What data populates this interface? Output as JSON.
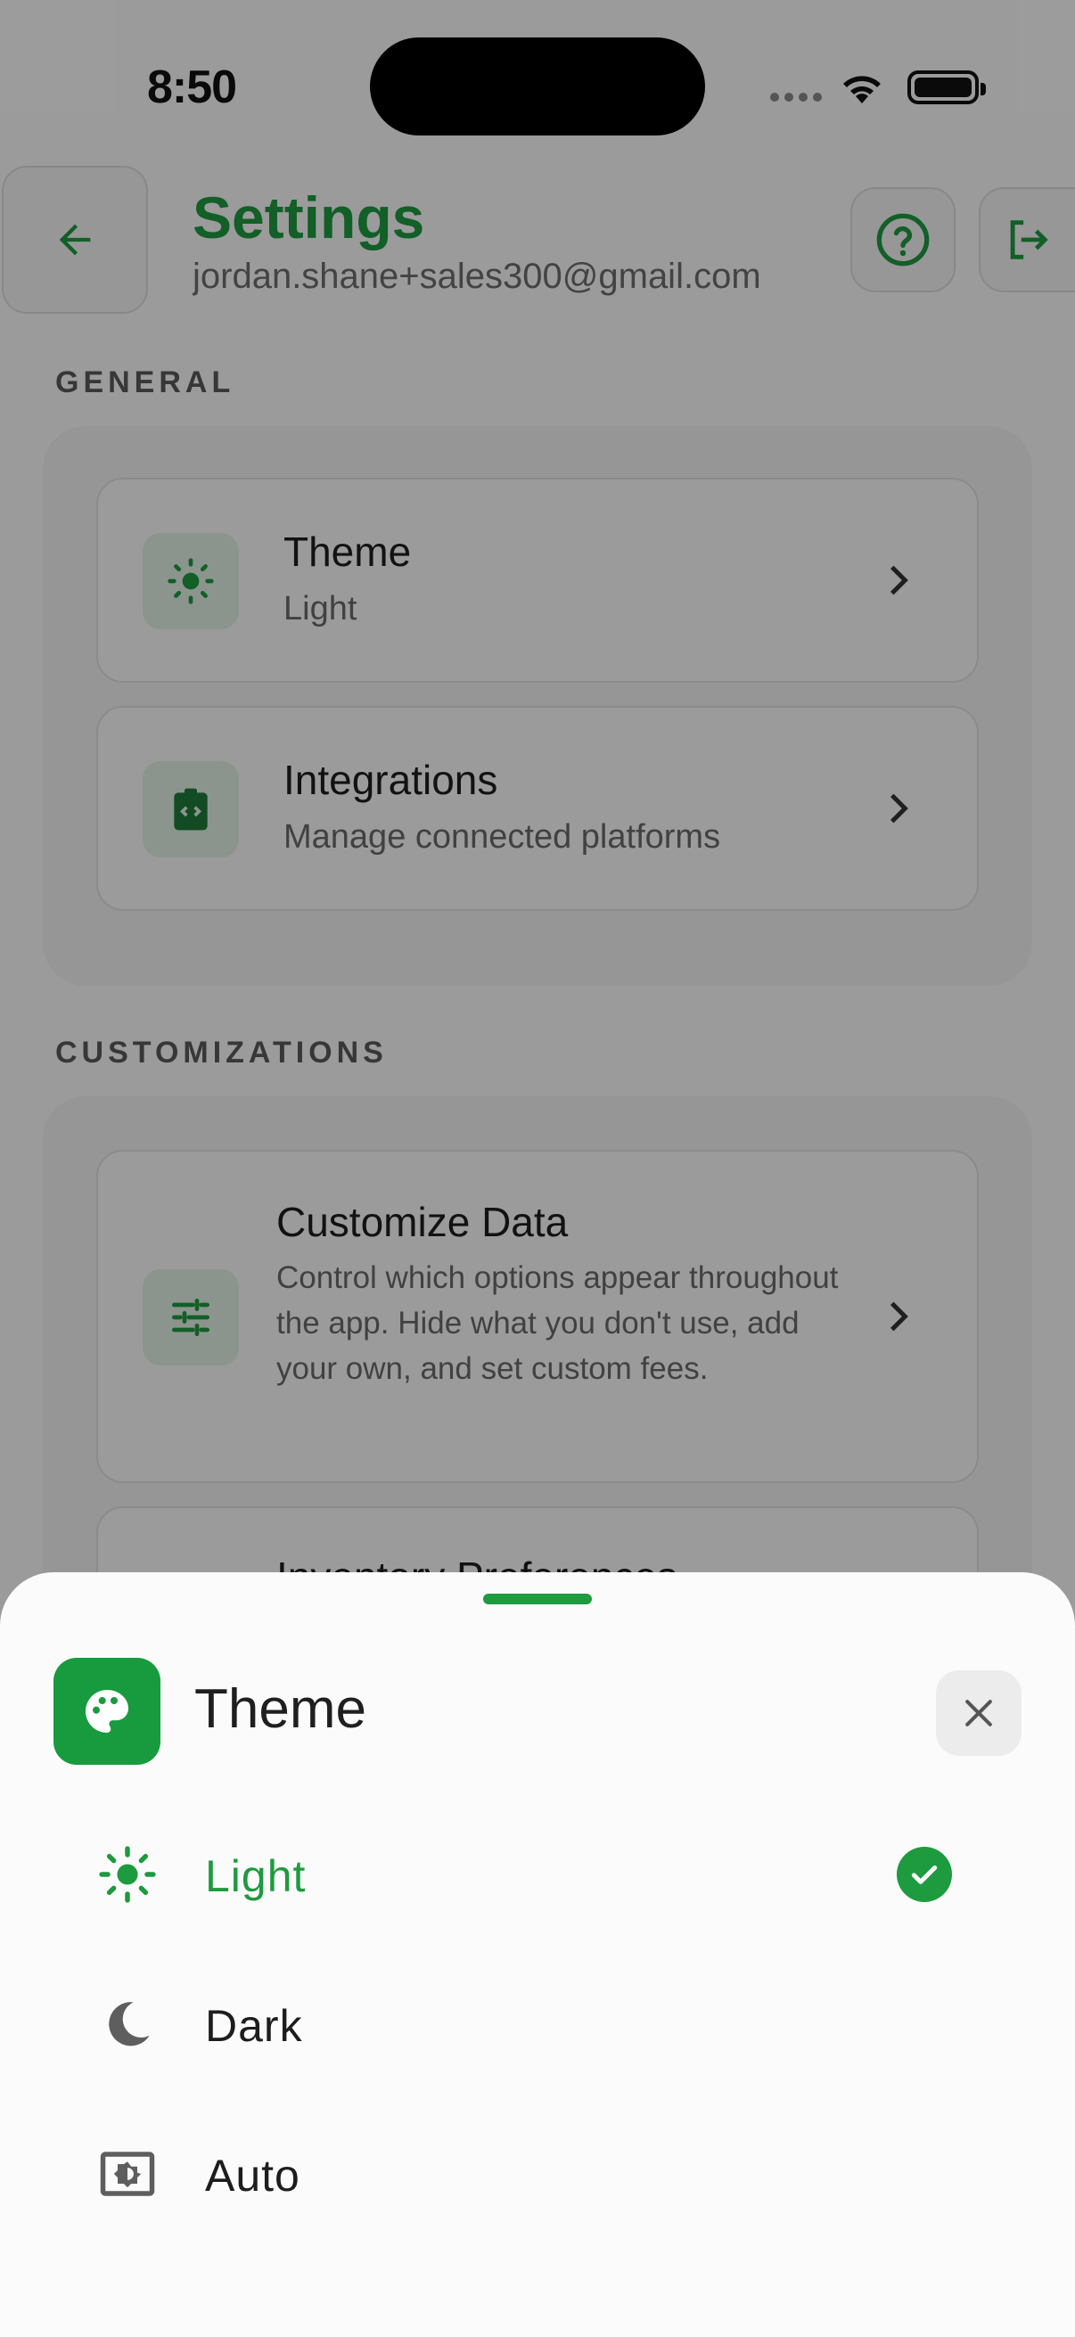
{
  "status_bar": {
    "time": "8:50"
  },
  "header": {
    "title": "Settings",
    "account_email": "jordan.shane+sales300@gmail.com"
  },
  "sections": {
    "general_label": "GENERAL",
    "general_items": [
      {
        "title": "Theme",
        "subtitle": "Light",
        "icon": "sun-icon"
      },
      {
        "title": "Integrations",
        "subtitle": "Manage connected platforms",
        "icon": "integration-clipboard-icon"
      }
    ],
    "customizations_label": "CUSTOMIZATIONS",
    "customizations_items": [
      {
        "title": "Customize Data",
        "subtitle": "Control which options appear throughout the app. Hide what you don't use, add your own, and set custom fees.",
        "icon": "sliders-icon"
      },
      {
        "title": "Inventory Preferences",
        "subtitle": "",
        "icon": ""
      }
    ]
  },
  "sheet": {
    "title": "Theme",
    "icon": "palette-icon",
    "options": [
      {
        "label": "Light",
        "icon": "sun-icon",
        "selected": true
      },
      {
        "label": "Dark",
        "icon": "moon-icon",
        "selected": false
      },
      {
        "label": "Auto",
        "icon": "brightness-auto-icon",
        "selected": false
      }
    ]
  },
  "colors": {
    "accent": "#1e9a3f",
    "icon_bg": "#e3efe6"
  }
}
